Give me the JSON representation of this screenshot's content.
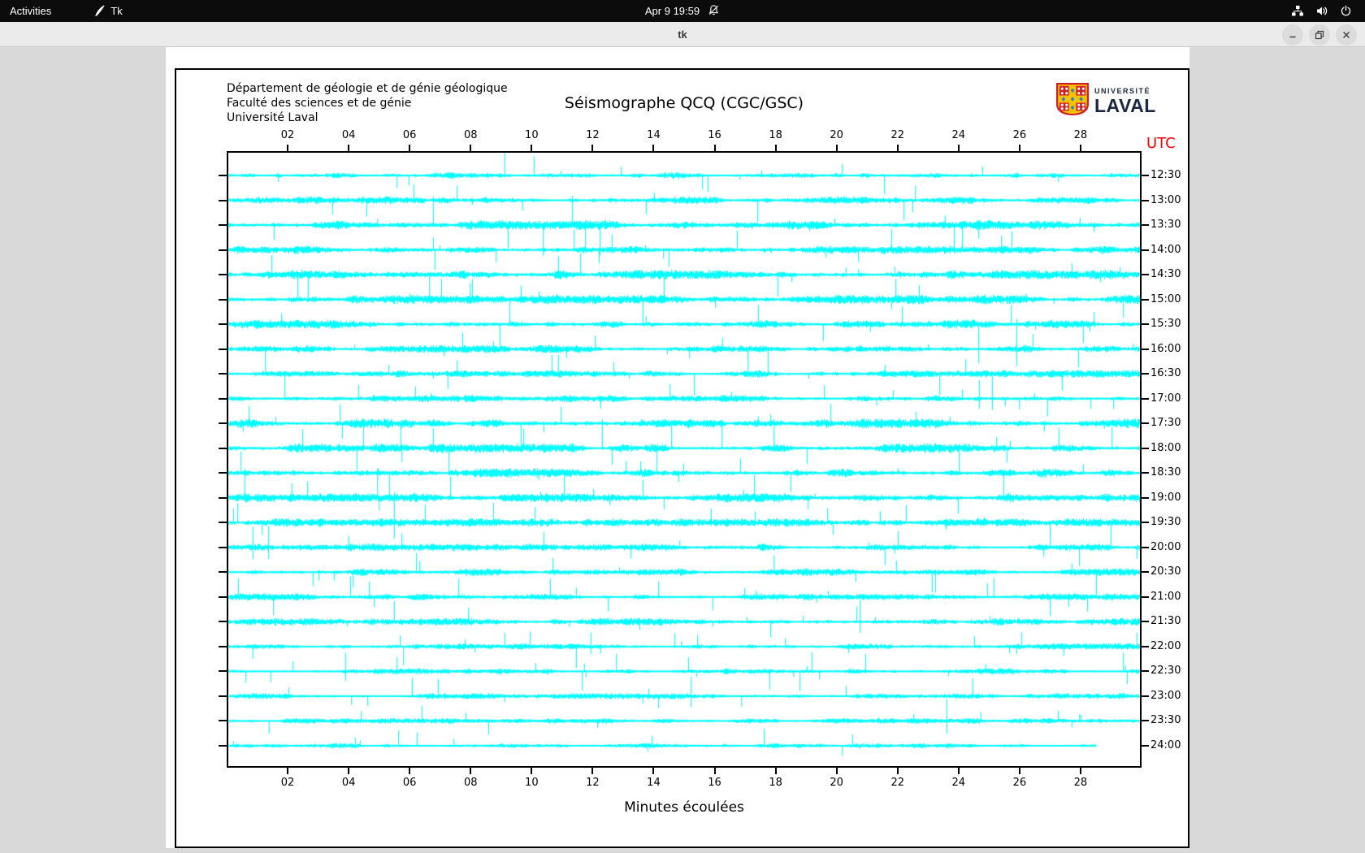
{
  "top_bar": {
    "activities_label": "Activities",
    "app_menu_label": "Tk",
    "clock": "Apr 9 19:59"
  },
  "window": {
    "title": "tk"
  },
  "header": {
    "institution_lines": [
      "Département de géologie et de génie géologique",
      "Faculté des sciences et de génie",
      "Université Laval"
    ],
    "title": "Séismographe QCQ (CGC/GSC)",
    "logo_text_top": "UNIVERSITÉ",
    "logo_text_bottom": "LAVAL"
  },
  "chart_data": {
    "type": "line",
    "kind": "seismogram-helicorder",
    "title": "Séismographe QCQ (CGC/GSC)",
    "xlabel": "Minutes écoulées",
    "x_range_minutes": [
      0,
      30
    ],
    "x_ticks": [
      "02",
      "04",
      "06",
      "08",
      "10",
      "12",
      "14",
      "16",
      "18",
      "20",
      "22",
      "24",
      "26",
      "28"
    ],
    "y_axis_label": "UTC",
    "rows": [
      {
        "utc": "12:30",
        "activity": 1.0
      },
      {
        "utc": "13:00",
        "activity": 1.0
      },
      {
        "utc": "13:30",
        "activity": 1.25
      },
      {
        "utc": "14:00",
        "activity": 1.1
      },
      {
        "utc": "14:30",
        "activity": 1.3
      },
      {
        "utc": "15:00",
        "activity": 1.25
      },
      {
        "utc": "15:30",
        "activity": 1.2
      },
      {
        "utc": "16:00",
        "activity": 1.1
      },
      {
        "utc": "16:30",
        "activity": 1.0
      },
      {
        "utc": "17:00",
        "activity": 1.0
      },
      {
        "utc": "17:30",
        "activity": 1.3
      },
      {
        "utc": "18:00",
        "activity": 1.25
      },
      {
        "utc": "18:30",
        "activity": 1.25
      },
      {
        "utc": "19:00",
        "activity": 1.2
      },
      {
        "utc": "19:30",
        "activity": 1.1
      },
      {
        "utc": "20:00",
        "activity": 1.0
      },
      {
        "utc": "20:30",
        "activity": 1.0
      },
      {
        "utc": "21:00",
        "activity": 0.95
      },
      {
        "utc": "21:30",
        "activity": 1.0
      },
      {
        "utc": "22:00",
        "activity": 0.85
      },
      {
        "utc": "22:30",
        "activity": 0.8
      },
      {
        "utc": "23:00",
        "activity": 0.8
      },
      {
        "utc": "23:30",
        "activity": 0.75
      },
      {
        "utc": "24:00",
        "activity": 0.7
      }
    ],
    "partial_last_row_end_minutes": 28.5,
    "grid": false,
    "legend": false,
    "trace_color": "#00ffff",
    "axis_color": "#000000",
    "utc_label_color": "#ff0000",
    "noise_seed": 7
  }
}
